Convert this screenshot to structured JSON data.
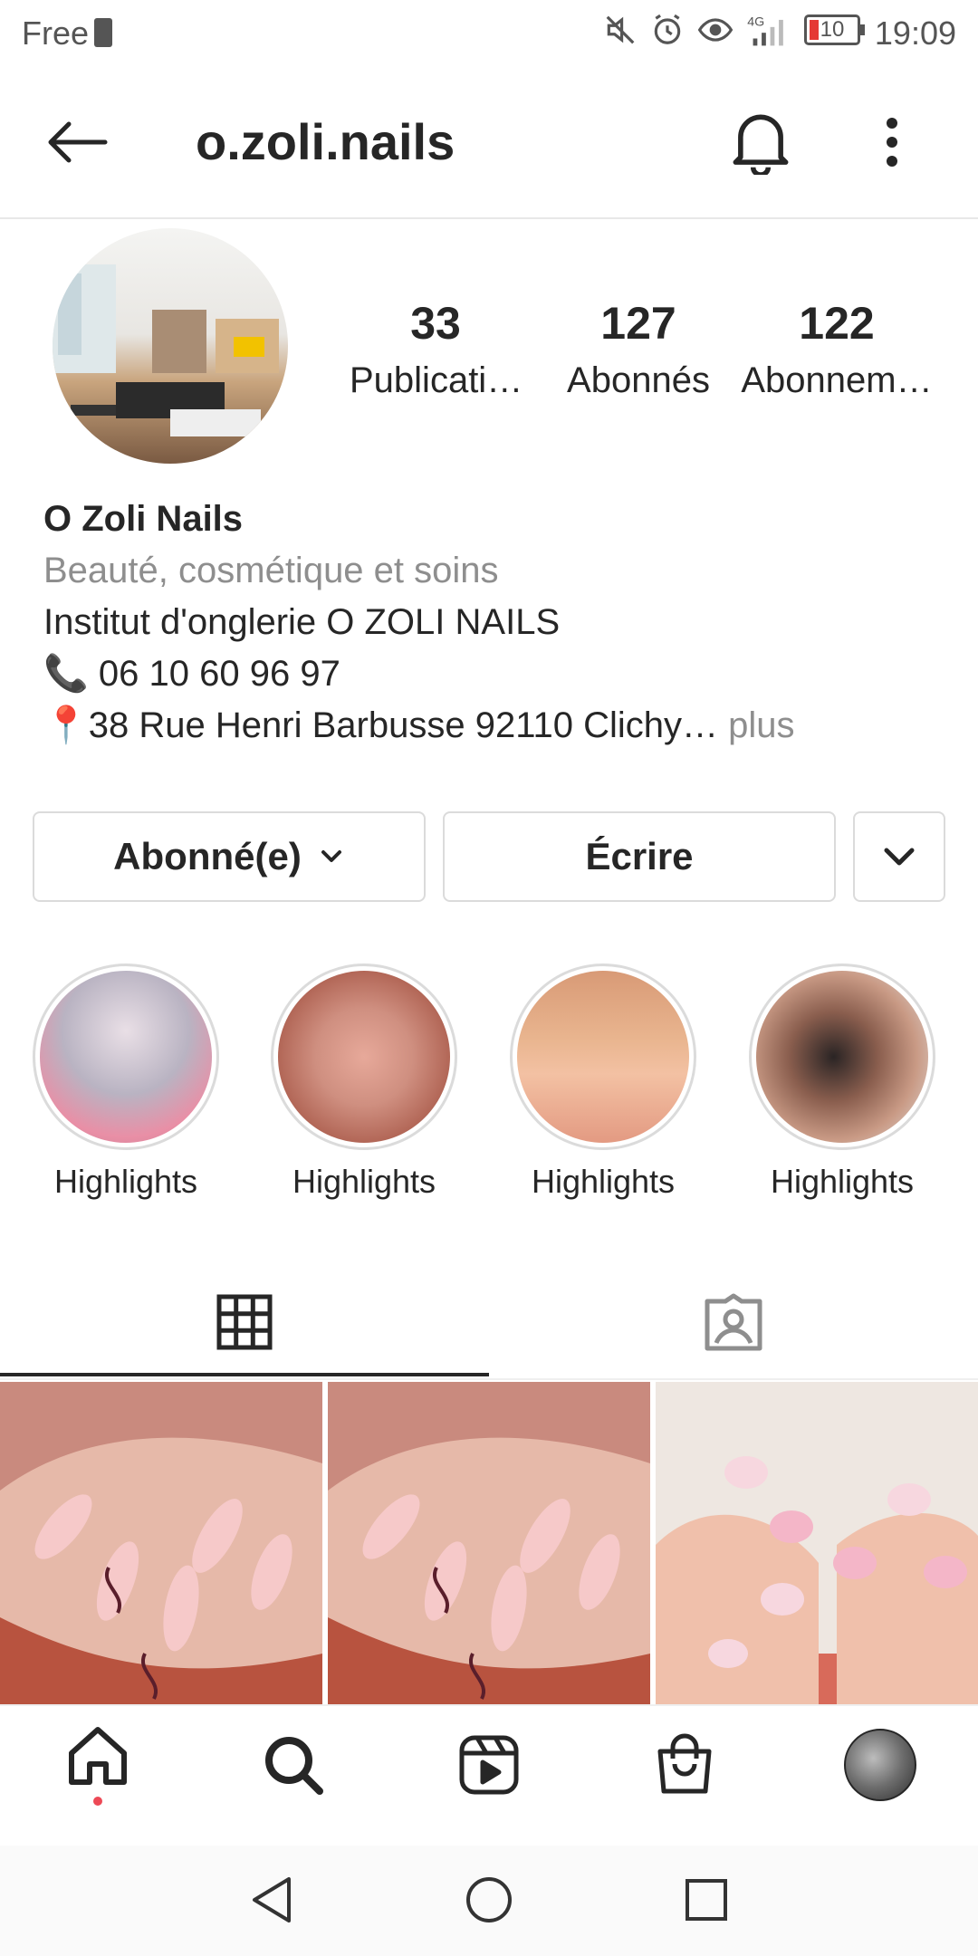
{
  "status_bar": {
    "carrier": "Free",
    "battery": "10",
    "time": "19:09"
  },
  "header": {
    "username": "o.zoli.nails"
  },
  "stats": [
    {
      "count": "33",
      "label": "Publicati…"
    },
    {
      "count": "127",
      "label": "Abonnés"
    },
    {
      "count": "122",
      "label": "Abonnem…"
    }
  ],
  "bio": {
    "name": "O Zoli Nails",
    "category": "Beauté, cosmétique et soins",
    "line1": "Institut d'onglerie O ZOLI NAILS",
    "phone": "📞 06 10 60 96 97",
    "address": "📍38 Rue Henri Barbusse 92110 Clichy…",
    "more": " plus"
  },
  "buttons": {
    "following": "Abonné(e)",
    "message": "Écrire"
  },
  "highlights": [
    {
      "label": "Highlights"
    },
    {
      "label": "Highlights"
    },
    {
      "label": "Highlights"
    },
    {
      "label": "Highlights"
    }
  ],
  "colors": {
    "text": "#262626",
    "muted": "#8e8e8e",
    "border": "#dbdbdb",
    "notification_dot": "#ed4956"
  }
}
